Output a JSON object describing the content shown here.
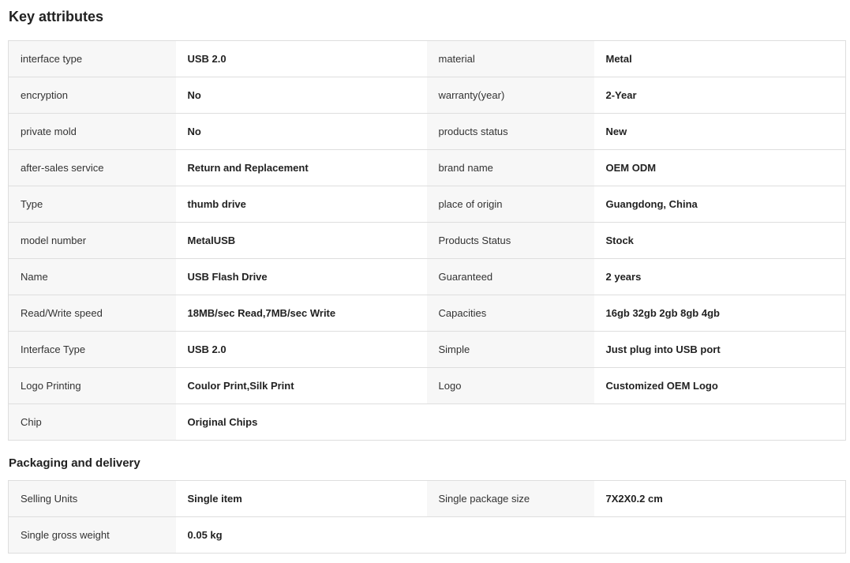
{
  "key_attributes": {
    "title": "Key attributes",
    "rows": [
      {
        "label_left": "interface type",
        "value_left": "USB 2.0",
        "label_right": "material",
        "value_right": "Metal"
      },
      {
        "label_left": "encryption",
        "value_left": "No",
        "label_right": "warranty(year)",
        "value_right": "2-Year"
      },
      {
        "label_left": "private mold",
        "value_left": "No",
        "label_right": "products status",
        "value_right": "New"
      },
      {
        "label_left": "after-sales service",
        "value_left": "Return and Replacement",
        "label_right": "brand name",
        "value_right": "OEM ODM"
      },
      {
        "label_left": "Type",
        "value_left": "thumb drive",
        "label_right": "place of origin",
        "value_right": "Guangdong, China"
      },
      {
        "label_left": "model number",
        "value_left": "MetalUSB",
        "label_right": "Products Status",
        "value_right": "Stock"
      },
      {
        "label_left": "Name",
        "value_left": "USB Flash Drive",
        "label_right": "Guaranteed",
        "value_right": "2 years"
      },
      {
        "label_left": "Read/Write speed",
        "value_left": "18MB/sec Read,7MB/sec Write",
        "label_right": "Capacities",
        "value_right": "16gb 32gb 2gb 8gb 4gb"
      },
      {
        "label_left": "Interface Type",
        "value_left": "USB 2.0",
        "label_right": "Simple",
        "value_right": "Just plug into USB port"
      },
      {
        "label_left": "Logo Printing",
        "value_left": "Coulor Print,Silk Print",
        "label_right": "Logo",
        "value_right": "Customized OEM Logo"
      },
      {
        "label_left": "Chip",
        "value_left": "Original Chips"
      }
    ]
  },
  "packaging_delivery": {
    "title": "Packaging and delivery",
    "rows": [
      {
        "label_left": "Selling Units",
        "value_left": "Single item",
        "label_right": "Single package size",
        "value_right": "7X2X0.2 cm"
      },
      {
        "label_left": "Single gross weight",
        "value_left": "0.05 kg"
      }
    ]
  },
  "colors": {
    "label_background": "#f7f7f7",
    "border": "#dedede",
    "text": "#222222"
  }
}
